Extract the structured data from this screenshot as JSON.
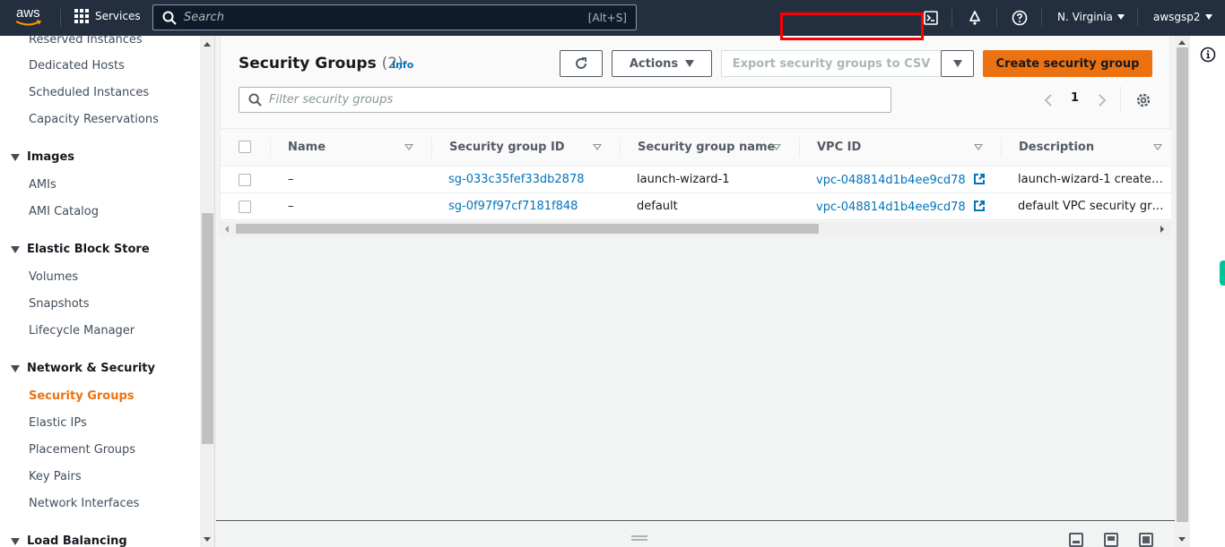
{
  "topnav": {
    "logo_text": "aws",
    "services_label": "Services",
    "search_placeholder": "Search",
    "search_shortcut": "[Alt+S]",
    "region_label": "N. Virginia",
    "account_label": "awsgsp2",
    "icons": [
      "cloudshell-icon",
      "bell-icon",
      "help-icon"
    ]
  },
  "sidebar": {
    "items": [
      {
        "label": "Reserved Instances"
      },
      {
        "label": "Dedicated Hosts"
      },
      {
        "label": "Scheduled Instances"
      },
      {
        "label": "Capacity Reservations"
      }
    ],
    "sections": [
      {
        "label": "Images",
        "items": [
          {
            "label": "AMIs"
          },
          {
            "label": "AMI Catalog"
          }
        ]
      },
      {
        "label": "Elastic Block Store",
        "items": [
          {
            "label": "Volumes"
          },
          {
            "label": "Snapshots"
          },
          {
            "label": "Lifecycle Manager"
          }
        ]
      },
      {
        "label": "Network & Security",
        "items": [
          {
            "label": "Security Groups",
            "active": true
          },
          {
            "label": "Elastic IPs"
          },
          {
            "label": "Placement Groups"
          },
          {
            "label": "Key Pairs"
          },
          {
            "label": "Network Interfaces"
          }
        ]
      },
      {
        "label": "Load Balancing",
        "items": []
      }
    ]
  },
  "main": {
    "title": "Security Groups",
    "count": "(2)",
    "info_label": "Info",
    "actions_label": "Actions",
    "export_label": "Export security groups to CSV",
    "create_label": "Create security group",
    "filter_placeholder": "Filter security groups",
    "page_number": "1",
    "table": {
      "columns": [
        "Name",
        "Security group ID",
        "Security group name",
        "VPC ID",
        "Description"
      ],
      "rows": [
        {
          "name": "–",
          "sg_id": "sg-033c35fef33db2878",
          "sg_name": "launch-wizard-1",
          "vpc_id": "vpc-048814d1b4ee9cd78",
          "description": "launch-wizard-1 create…"
        },
        {
          "name": "–",
          "sg_id": "sg-0f97f97cf7181f848",
          "sg_name": "default",
          "vpc_id": "vpc-048814d1b4ee9cd78",
          "description": "default VPC security gr…"
        }
      ]
    }
  },
  "colors": {
    "nav_bg": "#232f3e",
    "accent_orange": "#ec7211",
    "link_blue": "#0073bb",
    "highlight_red": "#ff0000",
    "rail_green": "#01c29a"
  }
}
